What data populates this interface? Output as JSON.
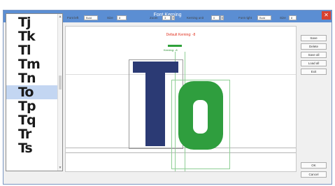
{
  "window": {
    "title": "Font Kerning",
    "close_symbol": "✕"
  },
  "glyph_list": {
    "items": [
      "Tj",
      "Tk",
      "Tl",
      "Tm",
      "Tn",
      "To",
      "Tp",
      "Tq",
      "Tr",
      "Ts"
    ],
    "selected_index": 5
  },
  "toolbar": {
    "font1_label": "Font left",
    "font1_value": "Bold",
    "size1_label": "Size",
    "size1_value": "8",
    "zoom_label": "Zoom",
    "zoom_value": "3",
    "kerning_label": "Kerning unit",
    "kerning_value": "0",
    "font2_label": "Font right",
    "font2_value": "Bold",
    "size2_label": "Size",
    "size2_value": "8"
  },
  "canvas": {
    "info_text": "Default Kerning: -8",
    "green_info_text": "Kerning: -8",
    "left_letter": "T",
    "right_letter": "O",
    "left_letter_color": "#2b3a74",
    "right_letter_color": "#2f9e3e"
  },
  "buttons": {
    "b1": "Save",
    "b2": "Delete",
    "b3": "Save all",
    "b4": "Load all",
    "b5": "Exit",
    "ok": "OK",
    "cancel": "Cancel"
  }
}
